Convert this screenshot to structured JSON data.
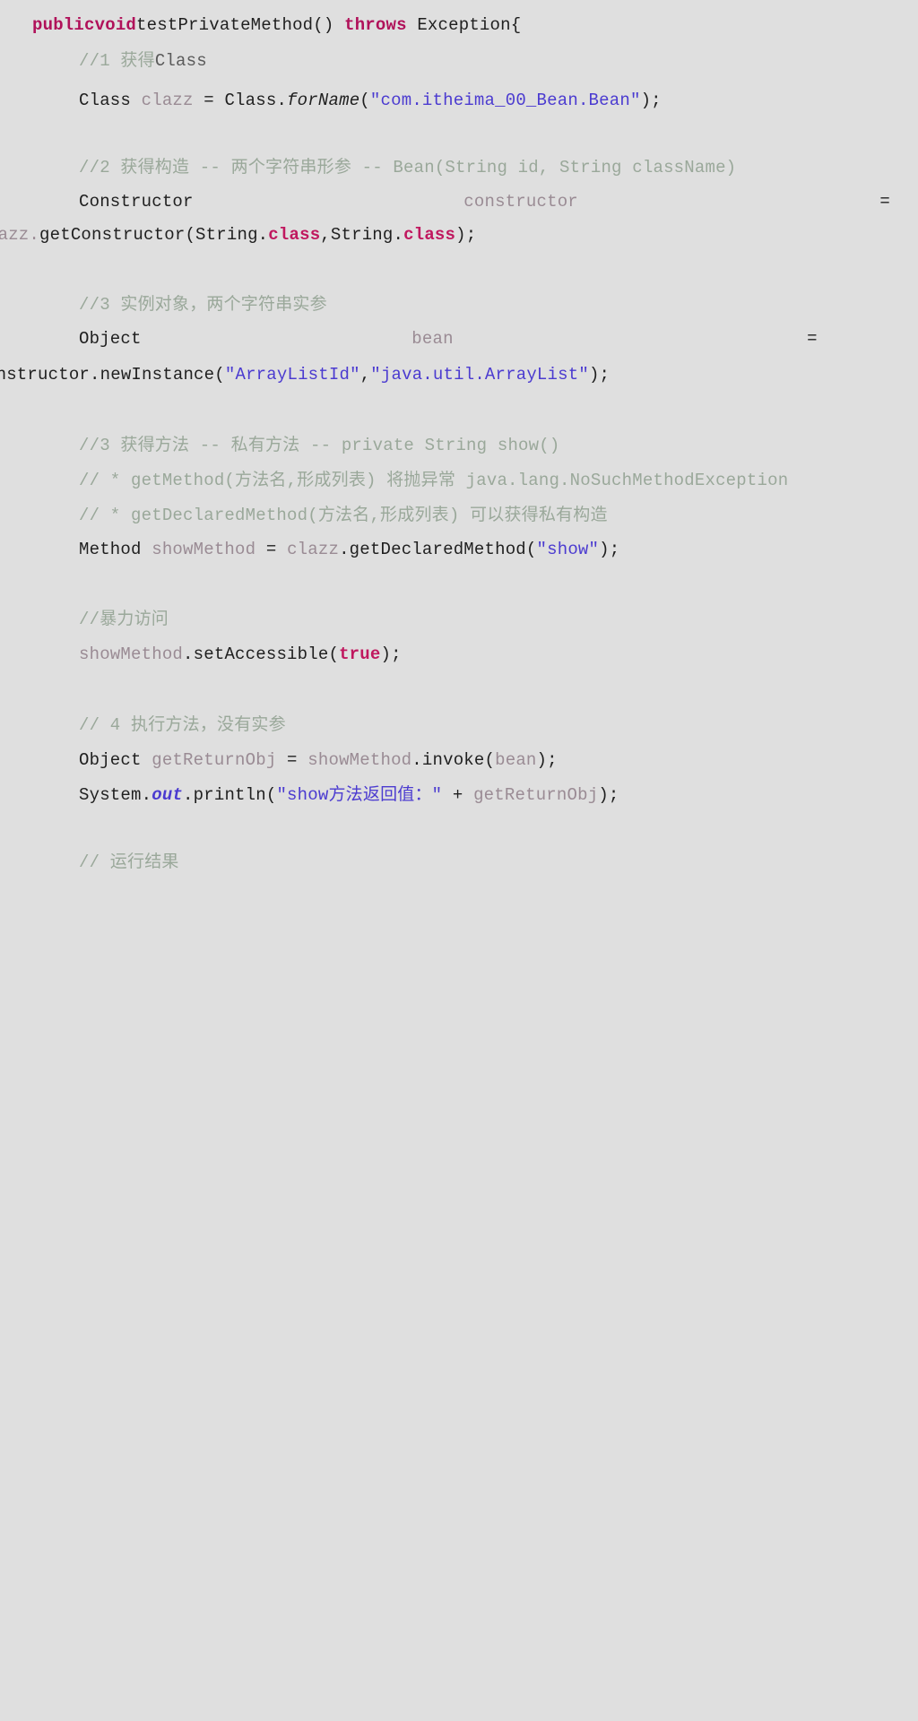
{
  "editor": {
    "background_color": "#dfdfdf",
    "default_text_color": "#1f1f1f",
    "language": "java",
    "font_size_px": 19,
    "line_height_px": 37,
    "colors": {
      "keyword": "#b0115a",
      "string": "#4b3bd0",
      "comment": "#9aa89a",
      "variable": "#9a8b94",
      "static_field": "#4b3bd0",
      "plain": "#1f1f1f"
    }
  },
  "code": {
    "line01": {
      "kw_public": "public",
      "kw_void": "void",
      "method_name": "testPrivateMethod()",
      "kw_throws": "throws",
      "tail": " Exception{"
    },
    "line02": {
      "comment": "//1 获得",
      "comment_code": "Class"
    },
    "line03": {
      "type": "Class ",
      "var": "clazz",
      "eq": " = ",
      "cls": "Class.",
      "method": "forName",
      "paren_open": "(",
      "string": "\"com.itheima_00_Bean.Bean\"",
      "tail": ");"
    },
    "line04": {
      "comment": "//2 获得构造 -- 两个字符串形参 -- Bean(String id, String className)"
    },
    "line05": {
      "type": "Constructor",
      "spacer1": "                          ",
      "var": "constructor",
      "spacer2": "                             ",
      "eq": "="
    },
    "line06": {
      "wrap_head": "lazz.",
      "method": "getConstructor",
      "args_a": "(String.",
      "kw_class_1": "class",
      "comma": ",String.",
      "kw_class_2": "class",
      "tail": ");"
    },
    "line07": {
      "comment": "//3 实例对象，两个字符串实参"
    },
    "line08": {
      "type": "Object",
      "spacer1": "                          ",
      "var": "bean",
      "spacer2": "                                  ",
      "eq": "="
    },
    "line09": {
      "wrap_head": "onstructor.",
      "method": "newInstance",
      "paren_open": "(",
      "string_1": "\"ArrayListId\"",
      "comma": ",",
      "string_2": "\"java.util.ArrayList\"",
      "tail": ");"
    },
    "line10": {
      "comment": "//3 获得方法 -- 私有方法 -- private String show()"
    },
    "line11": {
      "comment": "// * getMethod(方法名,形成列表) 将抛异常 java.lang.NoSuchMethodException"
    },
    "line12": {
      "comment": "// * getDeclaredMethod(方法名,形成列表) 可以获得私有构造"
    },
    "line13": {
      "type": "Method ",
      "var": "showMethod",
      "eq": " = ",
      "obj": "clazz",
      "dot_method": ".getDeclaredMethod(",
      "string": "\"show\"",
      "tail": ");"
    },
    "line14": {
      "comment": "//暴力访问"
    },
    "line15": {
      "var": "showMethod",
      "call": ".setAccessible(",
      "kw_true": "true",
      "tail": ");"
    },
    "line16": {
      "comment": "// 4 执行方法，没有实参"
    },
    "line17": {
      "type": "Object ",
      "var": "getReturnObj",
      "eq": " = ",
      "obj": "showMethod",
      "call": ".invoke(",
      "arg": "bean",
      "tail": ");"
    },
    "line18": {
      "sys": "System.",
      "static_out": "out",
      "println": ".println(",
      "string": "\"show方法返回值：\"",
      "plus": " + ",
      "arg": "getReturnObj",
      "tail": ");"
    },
    "line19": {
      "comment": "// 运行结果"
    }
  }
}
